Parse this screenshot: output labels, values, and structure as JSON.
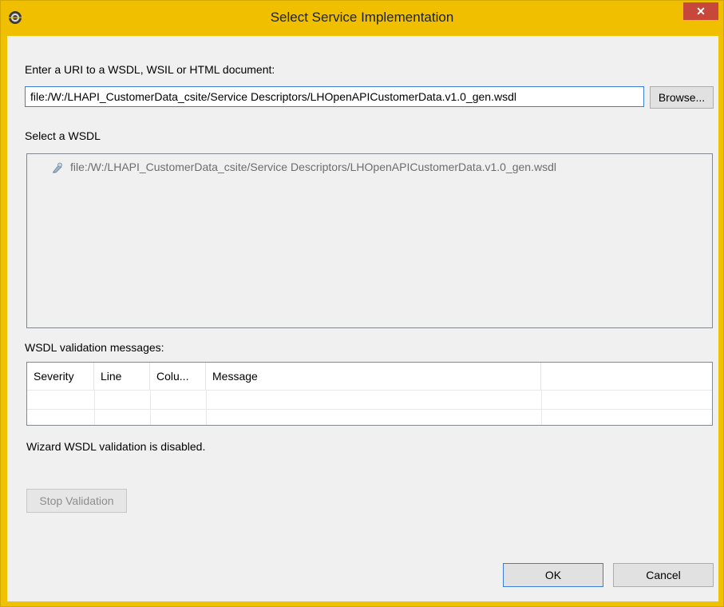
{
  "window": {
    "title": "Select Service Implementation",
    "close_label": "✕"
  },
  "uri": {
    "label": "Enter a URI to a WSDL, WSIL or HTML document:",
    "value": "file:/W:/LHAPI_CustomerData_csite/Service Descriptors/LHOpenAPICustomerData.v1.0_gen.wsdl",
    "browse_label": "Browse..."
  },
  "wsdl_select": {
    "label": "Select a WSDL",
    "items": [
      {
        "icon": "wsdl-file-icon",
        "text": "file:/W:/LHAPI_CustomerData_csite/Service Descriptors/LHOpenAPICustomerData.v1.0_gen.wsdl"
      }
    ]
  },
  "validation": {
    "label": "WSDL validation messages:",
    "columns": [
      "Severity",
      "Line",
      "Colu...",
      "Message",
      ""
    ],
    "rows": [],
    "status_text": "Wizard WSDL validation is disabled.",
    "stop_label": "Stop Validation"
  },
  "footer": {
    "ok_label": "OK",
    "cancel_label": "Cancel"
  },
  "colors": {
    "title_bar": "#f0c000",
    "close_button": "#c7473a",
    "focus_border": "#3c7fd8"
  }
}
